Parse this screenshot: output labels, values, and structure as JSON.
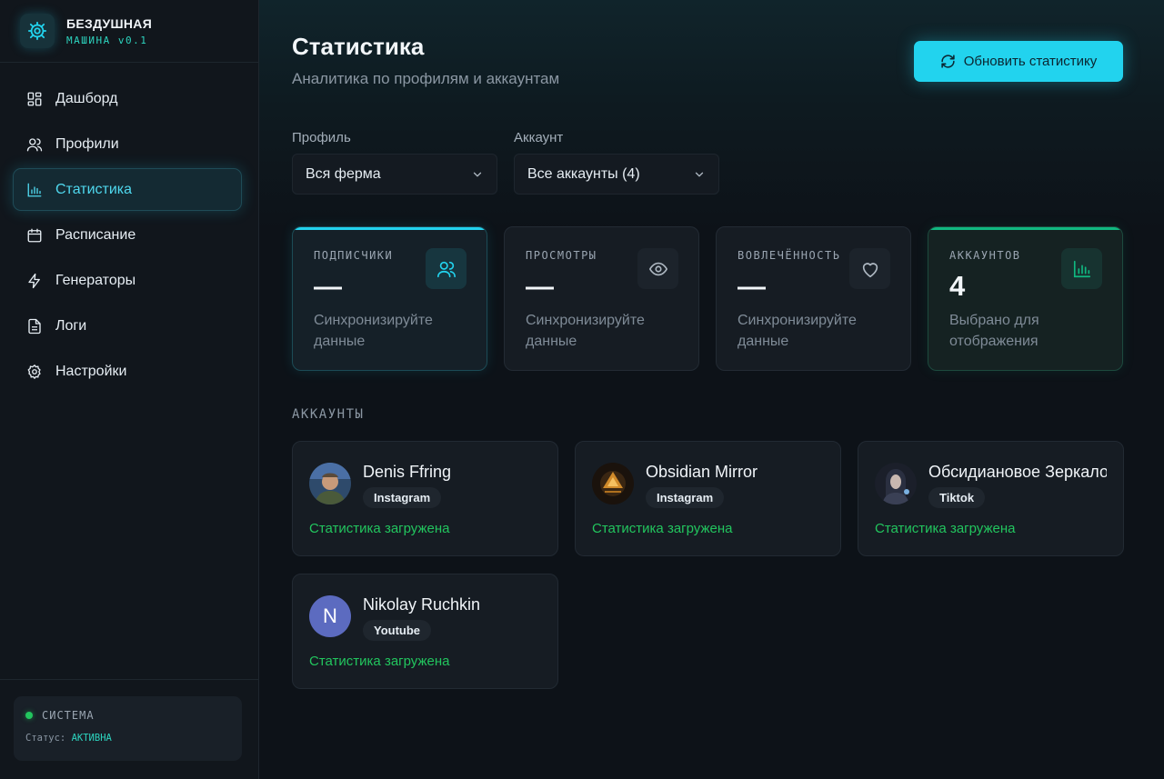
{
  "brand": {
    "title": "БЕЗДУШНАЯ",
    "subtitle": "МАШИНА v0.1",
    "logo_icon": "gear-icon",
    "accent": "#22d3ee"
  },
  "sidebar": {
    "items": [
      {
        "label": "Дашборд",
        "icon": "dashboard-icon",
        "active": false
      },
      {
        "label": "Профили",
        "icon": "users-icon",
        "active": false
      },
      {
        "label": "Статистика",
        "icon": "bar-chart-icon",
        "active": true
      },
      {
        "label": "Расписание",
        "icon": "calendar-icon",
        "active": false
      },
      {
        "label": "Генераторы",
        "icon": "lightning-icon",
        "active": false
      },
      {
        "label": "Логи",
        "icon": "file-icon",
        "active": false
      },
      {
        "label": "Настройки",
        "icon": "settings-icon",
        "active": false
      }
    ],
    "system": {
      "title": "СИСТЕМА",
      "status_label": "Статус:",
      "status_value": "АКТИВНА"
    }
  },
  "header": {
    "title": "Статистика",
    "subtitle": "Аналитика по профилям и аккаунтам",
    "refresh_label": "Обновить статистику"
  },
  "filters": {
    "profile": {
      "label": "Профиль",
      "value": "Вся ферма"
    },
    "account": {
      "label": "Аккаунт",
      "value": "Все аккаунты (4)"
    }
  },
  "stats": [
    {
      "label": "ПОДПИСЧИКИ",
      "value": "—",
      "desc": "Синхронизируйте данные",
      "icon": "users-icon"
    },
    {
      "label": "ПРОСМОТРЫ",
      "value": "—",
      "desc": "Синхронизируйте данные",
      "icon": "eye-icon"
    },
    {
      "label": "ВОВЛЕЧЁННОСТЬ",
      "value": "—",
      "desc": "Синхронизируйте данные",
      "icon": "heart-icon"
    },
    {
      "label": "АККАУНТОВ",
      "value": "4",
      "desc": "Выбрано для отображения",
      "icon": "bar-chart-icon"
    }
  ],
  "accounts_section": {
    "title": "АККАУНТЫ",
    "items": [
      {
        "name": "Denis Ffring",
        "platform": "Instagram",
        "status": "Статистика загружена",
        "avatar": "photo"
      },
      {
        "name": "Obsidian Mirror",
        "platform": "Instagram",
        "status": "Статистика загружена",
        "avatar": "photo"
      },
      {
        "name": "Обсидиановое Зеркало",
        "platform": "Tiktok",
        "status": "Статистика загружена",
        "avatar": "photo"
      },
      {
        "name": "Nikolay Ruchkin",
        "platform": "Youtube",
        "status": "Статистика загружена",
        "avatar": "N",
        "avatar_color": "#5c6bc0"
      }
    ]
  }
}
